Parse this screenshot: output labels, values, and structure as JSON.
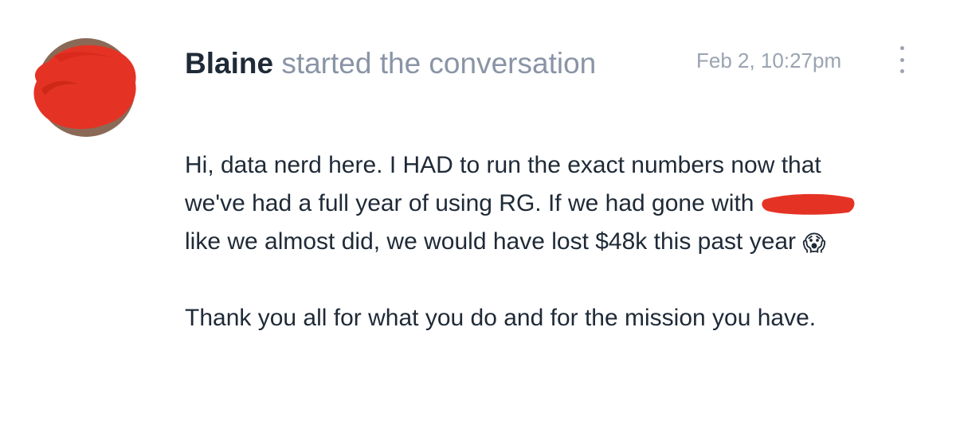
{
  "message": {
    "author": "Blaine",
    "action_text": " started the conversation",
    "timestamp": "Feb 2, 10:27pm",
    "body": {
      "paragraph_1_part_1": "Hi, data nerd here. I HAD to run the exact numbers now that we've had a full year of using RG. If we had gone with ",
      "paragraph_1_part_2": " like we almost did, we would have lost $48k this past year ",
      "emoji": "😱",
      "paragraph_2": "Thank you all for what you do and for the mission you have."
    }
  },
  "icons": {
    "menu": "more-vertical-icon",
    "emoji": "screaming-face-icon"
  },
  "colors": {
    "redaction": "#e43325",
    "author_text": "#1f2a37",
    "muted_text": "#8a94a6",
    "body_text": "#1f2a37"
  }
}
